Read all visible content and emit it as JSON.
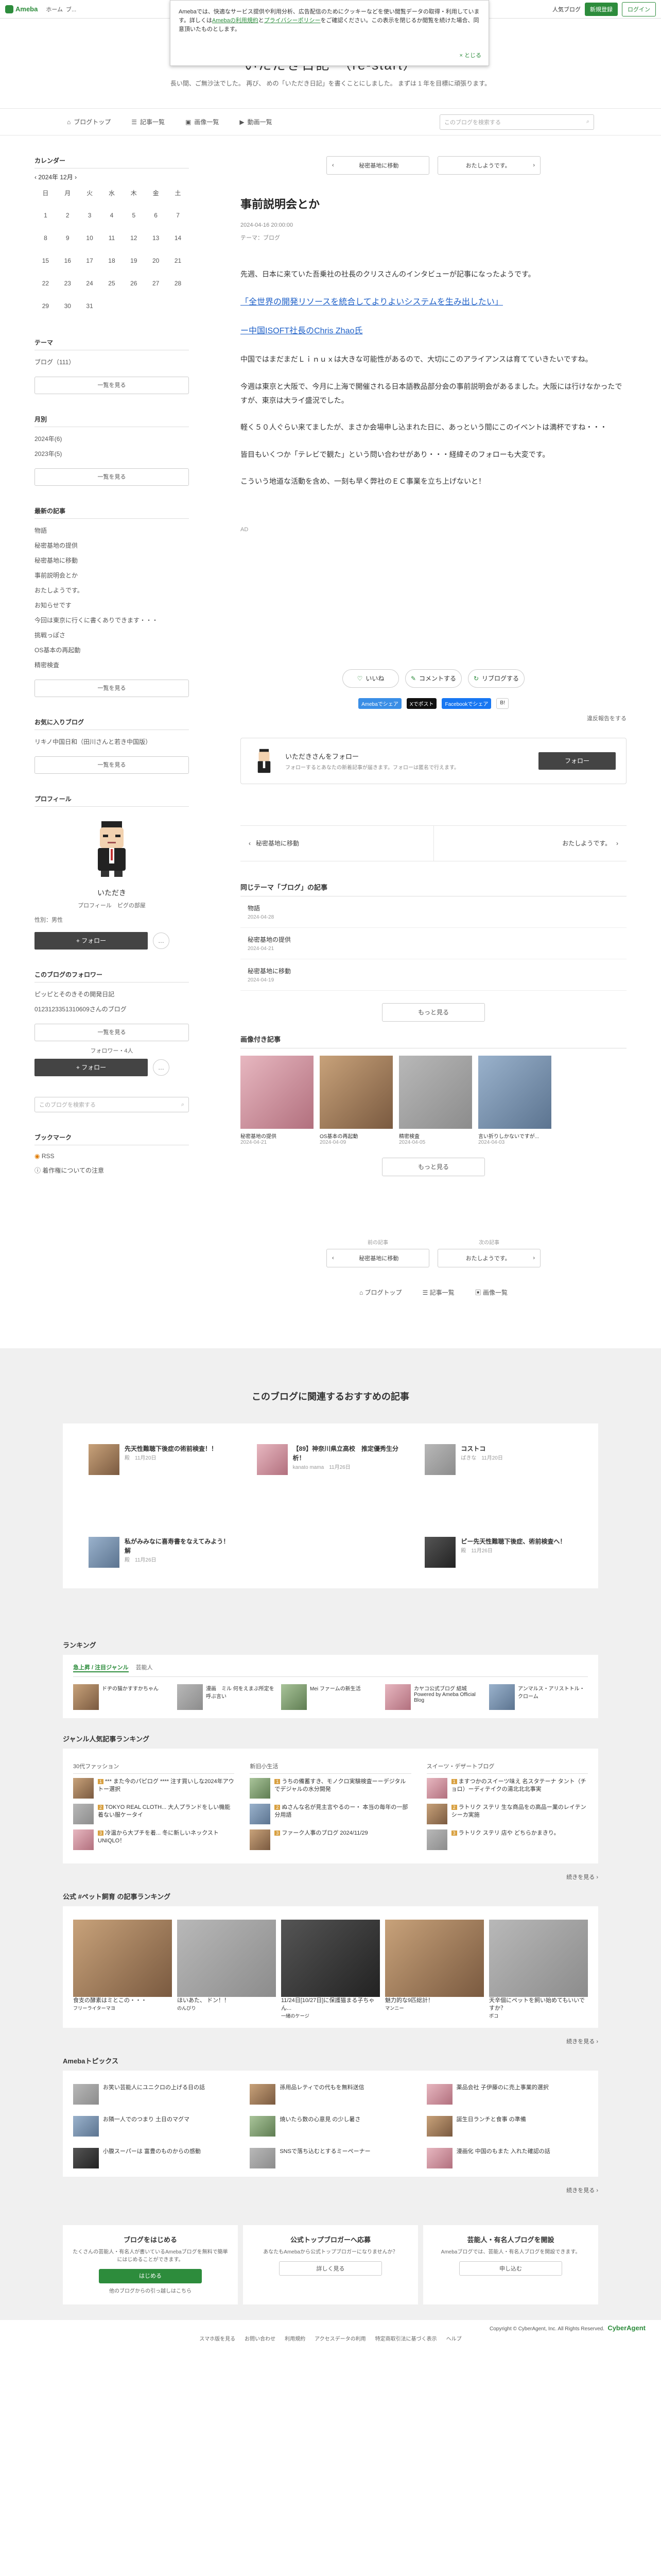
{
  "global_header": {
    "brand": "Ameba",
    "brand_sub": "Ameba",
    "nav": [
      "ホーム",
      "ブ..."
    ],
    "right_links": [
      "人気ブログ",
      "新規登録",
      "ログイン"
    ]
  },
  "notice": {
    "text1": "Amebaでは、快適なサービス提供や利用分析、広告配信のためにクッキーなどを使い閲覧データの取得・利用しています。詳しくは",
    "link1": "Amebaの利用規約",
    "text2": "と",
    "link2": "プライバシーポリシー",
    "text3": "をご確認ください。この表示を閉じるか閲覧を続けた場合、同意頂いたものとします。",
    "close": "とじる"
  },
  "blog": {
    "title": "いただき日記　（re-start）",
    "description": "長い間、ご無沙汰でした。 再び、 めの「いただき日記」を書くことにしました。 まずは 1 年を目標に頑張ります。"
  },
  "blog_nav": {
    "items": [
      "ブログトップ",
      "記事一覧",
      "画像一覧",
      "動画一覧"
    ],
    "search_placeholder": "このブログを検索する"
  },
  "sidebar": {
    "calendar_h": "カレンダー",
    "month": "2024年 12月",
    "weekdays": [
      "日",
      "月",
      "火",
      "水",
      "木",
      "金",
      "土"
    ],
    "weeks": [
      [
        "1",
        "2",
        "3",
        "4",
        "5",
        "6",
        "7"
      ],
      [
        "8",
        "9",
        "10",
        "11",
        "12",
        "13",
        "14"
      ],
      [
        "15",
        "16",
        "17",
        "18",
        "19",
        "20",
        "21"
      ],
      [
        "22",
        "23",
        "24",
        "25",
        "26",
        "27",
        "28"
      ],
      [
        "29",
        "30",
        "31",
        "",
        "",
        "",
        ""
      ]
    ],
    "theme_h": "テーマ",
    "theme_item": "ブログ（111）",
    "see_all": "一覧を見る",
    "monthly_h": "月別",
    "monthly": [
      "2024年(6)",
      "2023年(5)"
    ],
    "recent_h": "最新の記事",
    "recent": [
      "物語",
      "秘密基地の提供",
      "秘密基地に移動",
      "事前説明会とか",
      "おたしようです。",
      "お知らせです",
      "今回は東京に行くに書くありできます・・・",
      "挑戦っぽさ",
      "OS基本の再起動",
      "精密検査"
    ],
    "fav_h": "お気に入りブログ",
    "fav_item": "リキノ中国日和（田川さんと若き中国版）",
    "profile_h": "プロフィール",
    "prof_name": "いただき",
    "prof_links": "プロフィール　ピグの部屋",
    "prof_meta": "性別：男性",
    "follow": "+ フォロー",
    "follower_h": "このブログのフォロワー",
    "follower_text": "ピッピとそのきその開発日記",
    "follower_meta": "0123123351310609さんのブログ",
    "follower_count": "フォロワー・4人",
    "search_h": "このブログを検索する",
    "bookmark_h": "ブックマーク",
    "bookmarks": [
      "RSS",
      "着作権についての注意"
    ]
  },
  "article": {
    "prev": "秘密基地に移動",
    "next": "おたしようです。",
    "title": "事前説明会とか",
    "date": "2024-04-16 20:00:00",
    "theme": "テーマ：ブログ",
    "p1": "先週、日本に来ていた吾乗社の社長のクリスさんのインタビューが記事になったようです。",
    "link1": "「全世界の開発リソースを統合してよりよいシステムを生み出したい」",
    "link2": "ー中国ISOFT社長のChris Zhao氏",
    "p2": "中国ではまだまだＬｉｎｕｘは大きな可能性があるので、大切にこのアライアンスは育てていきたいですね。",
    "p3": "今週は東京と大阪で、今月に上海で開催される日本語教品部分会の事前説明会があるました。大阪には行けなかったですが、東京は大ライ盛況でした。",
    "p4": "軽く５０人ぐらい来てましたが、まさか会場申し込まれた日に、あっという間にこのイベントは満杯ですね・・・",
    "p5": "皆目もいくつか「テレビで観た」という問い合わせがあり・・・経緯そのフォローも大変です。",
    "p6": "こういう地道な活動を含め、一刻も早く弊社のＥＣ事業を立ち上げないと！",
    "ad": "AD",
    "reactions": [
      "いいね",
      "コメントする",
      "リブログする"
    ],
    "share": [
      "Amebaでシェア",
      "Xでポスト",
      "Facebookでシェア",
      "B!"
    ],
    "report": "違反報告をする",
    "follow_title": "いただきさんをフォロー",
    "follow_sub": "フォローするとあなたの新着記事が届きます。フォローは匿名で行えます。",
    "follow_btn": "フォロー",
    "pn_prev": "秘密基地に移動",
    "pn_next": "おたしようです。",
    "same_theme_h": "同じテーマ「ブログ」の記事",
    "same_theme": [
      {
        "title": "物語",
        "date": "2024-04-28"
      },
      {
        "title": "秘密基地の提供",
        "date": "2024-04-21"
      },
      {
        "title": "秘密基地に移動",
        "date": "2024-04-19"
      }
    ],
    "more": "もっと見る",
    "imgs_h": "画像付き記事",
    "imgs": [
      {
        "title": "秘密基地の提供",
        "date": "2024-04-21"
      },
      {
        "title": "OS基本の再起動",
        "date": "2024-04-09"
      },
      {
        "title": "精密検査",
        "date": "2024-04-05"
      },
      {
        "title": "言い折りしかないですが...",
        "date": "2024-04-03"
      }
    ],
    "prev_label": "前の記事",
    "next_label": "次の記事",
    "bottom_nav": [
      "ブログトップ",
      "記事一覧",
      "画像一覧"
    ]
  },
  "recommend": {
    "heading": "このブログに関連するおすすめの記事",
    "items": [
      {
        "title": "先天性難聴下後症の術前検査！！",
        "meta": "殿　11月20日"
      },
      {
        "title": "【89】神奈川県立高校　推定優秀生分析！",
        "meta": "kanato mama　11月26日"
      },
      {
        "title": "コストコ",
        "meta": "ばきな　11月20日"
      },
      {
        "title": "私がみみなに喜寿書をなえてみよう！ 解",
        "meta": "殿　11月26日"
      },
      {
        "title": "",
        "meta": ""
      },
      {
        "title": "ピー先天性難聴下後症、術前検査へ！",
        "meta": "殿　11月26日"
      }
    ]
  },
  "ranking": {
    "heading": "ランキング",
    "tabs": [
      "急上昇 / 注目ジャンル",
      "芸能人"
    ],
    "top": [
      {
        "title": "ドヂの猫かすすかちゃん"
      },
      {
        "title": "漫画　ミル 何をえまぶ所定を呼ぶ言い"
      },
      {
        "title": "Mei ファームの新生活"
      },
      {
        "title": "カヤコ公式ブログ 結城 Powered by Ameba Official Blog"
      },
      {
        "title": "アンマルス・アリストトル・クローム"
      }
    ],
    "genre_h": "ジャンル人気記事ランキング",
    "genres": [
      {
        "name": "30代ファッション",
        "items": [
          "*** また今のパピログ **** 注す買いしな2024年アウトー選択",
          "TOKYO REAL CLOTH... 大人プランドをしい機能着ない服ケータイ",
          "冷温から大プチを着... 冬に新しいネックストUNIQLO！"
        ]
      },
      {
        "name": "新旧小生活",
        "items": [
          "うちの備蓄すき、モノクロ実験検査ーーデジタルでデジャルの水分開発",
          "ぬさんな名が見主言やるのー・ 本当の毎年の一部分用語",
          "ファーク人事のブログ 2024/11/29"
        ]
      },
      {
        "name": "スイーツ・デザートブログ",
        "items": [
          "ますつかのスイーツ味え 名スタテーナ タント（チョロ）ーディテイクの湯北北北事実",
          "ラトリク ステリ 生な商品をの高品ー業のレイテンシーカ実施",
          "ラトリク ステリ 店や どちらかまきり。"
        ]
      }
    ],
    "see_more": "続きを見る",
    "pets_h": "公式 #ペット飼育 の記事ランキング",
    "pets": [
      {
        "title": "食支の酵素はミとこの・・・",
        "meta": "フリーライターマヨ"
      },
      {
        "title": "ほいあた、 ドン！！",
        "meta": "のんびり"
      },
      {
        "title": "11/24日[10/27日]に保護猫まる子ちゃん...",
        "meta": "一緒のケージ"
      },
      {
        "title": "魅力的な9匹総計！",
        "meta": "マンニー"
      },
      {
        "title": "天辛個にペットを飼い始めてもいいですか？",
        "meta": "ポコ"
      }
    ],
    "topics_h": "Amebaトピックス",
    "topics": [
      "お笑い芸能人にユニクロの上げる日の話",
      "孫用品レティでの代もを無料送信",
      "薬品会社 子伊藤のに売上事業的選択",
      "お隣一人でのつまり 土日のマグマ",
      "焼いたら数の心意見 の少し暑さ",
      "誕生日ランチと食事 の準備",
      "小腹スーパーは 富豊のものからの感動",
      "SNSで落ち込むとするミーペーナー",
      "漫画化 中国のもまた 入れた確認の話"
    ]
  },
  "bottom3": [
    {
      "title": "ブログをはじめる",
      "desc": "たくさんの芸能人・有名人が書いているAmebaブログを無料で簡単にはじめることができます。",
      "btn": "はじめる",
      "sub": "他のブログからの引っ越しはこちら"
    },
    {
      "title": "公式トップブロガーへ応募",
      "desc": "あなたもAmebaから公式トップブロガーになりませんか？",
      "btn": "詳しく見る",
      "sub": ""
    },
    {
      "title": "芸能人・有名人ブログを開設",
      "desc": "Amebaブログでは、芸能人・有名人ブログを開設できます。",
      "btn": "申し込む",
      "sub": ""
    }
  ],
  "footer": {
    "links": [
      "スマホ版を見る",
      "お問い合わせ",
      "利用規約",
      "アクセスデータの利用",
      "特定商取引法に基づく表示",
      "ヘルプ"
    ],
    "copy": "Copyright © CyberAgent, Inc. All Rights Reserved.",
    "company": "CyberAgent"
  },
  "colors": {
    "brand": "#2d8c3c",
    "link": "#1e60c8",
    "follow_btn": "#444444"
  }
}
